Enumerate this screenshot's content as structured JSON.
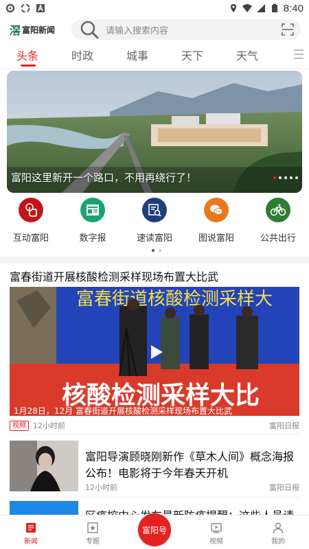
{
  "status": {
    "time": "8:40"
  },
  "header": {
    "logo_text": "富阳新闻",
    "search_placeholder": "请输入搜索内容"
  },
  "tabs": [
    {
      "label": "头条",
      "active": true
    },
    {
      "label": "时政",
      "active": false
    },
    {
      "label": "城事",
      "active": false
    },
    {
      "label": "天下",
      "active": false
    },
    {
      "label": "天气",
      "active": false
    }
  ],
  "banner": {
    "caption": "富阳这里新开一个路口，不用再绕行了！",
    "slide_count": 5,
    "active_slide": 1
  },
  "quick_links": [
    {
      "label": "互动富阳",
      "icon": "touch-icon",
      "color": "#c0151b"
    },
    {
      "label": "数字报",
      "icon": "newspaper-icon",
      "color": "#1aa36f"
    },
    {
      "label": "速读富阳",
      "icon": "quick-read-icon",
      "color": "#1f3e7a"
    },
    {
      "label": "图说富阳",
      "icon": "chat-bubbles-icon",
      "color": "#e8781e"
    },
    {
      "label": "公共出行",
      "icon": "bicycle-icon",
      "color": "#2e7d32"
    }
  ],
  "articles": [
    {
      "title": "富春街道开展核酸检测采样现场布置大比武",
      "video_banner_text": "富春街道核酸检测采样大",
      "video_bottom_text": "核酸检测采样大比",
      "video_caption": "1月28日，12月 富春街道开展核酸检测采样现场布置大比武",
      "badge": "视频",
      "time": "12小时前",
      "source": "富阳日报"
    },
    {
      "title": "富阳导演顾晓刚新作《草木人间》概念海报公布！电影将于今年春天开机",
      "time": "12小时前",
      "source": "富阳日报"
    },
    {
      "title": "区疫控中心发布最新防疫提醒：这些人员请"
    }
  ],
  "bottom_nav": [
    {
      "label": "新闻",
      "icon": "news-icon",
      "active": true
    },
    {
      "label": "专题",
      "icon": "topic-icon",
      "active": false
    },
    {
      "label": "富阳号",
      "icon": "",
      "active": false
    },
    {
      "label": "视频",
      "icon": "video-icon",
      "active": false
    },
    {
      "label": "我的",
      "icon": "user-icon",
      "active": false
    }
  ],
  "colors": {
    "accent": "#e02020"
  }
}
